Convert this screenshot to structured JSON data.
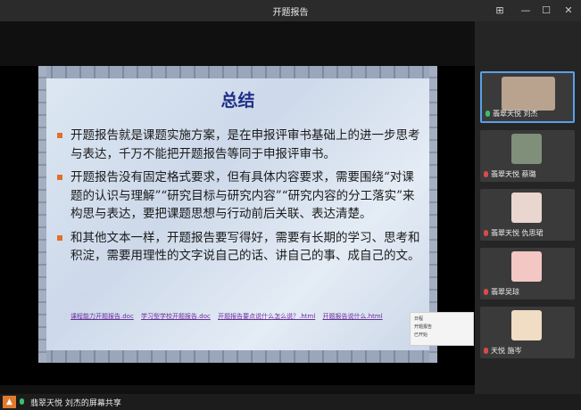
{
  "window": {
    "title": "开题报告"
  },
  "slide": {
    "title": "总结",
    "bullets": [
      "开题报告就是课题实施方案，是在申报评审书基础上的进一步思考与表达，千万不能把开题报告等同于申报评审书。",
      "开题报告没有固定格式要求，但有具体内容要求，需要围绕“对课题的认识与理解”“研究目标与研究内容”“研究内容的分工落实”来构思与表达，要把课题思想与行动前后关联、表达清楚。",
      "和其他文本一样，开题报告要写得好，需要有长期的学习、思考和积淀，需要用理性的文字说自己的话、讲自己的事、成自己的文。"
    ],
    "links": [
      "课程能力开题报告.doc",
      "学习型学校开题报告.doc",
      "开题报告要点说什么怎么说？.html",
      "开题报告说什么.html"
    ]
  },
  "popup": {
    "items": [
      "日程",
      "开题报告",
      "已开始"
    ]
  },
  "participants": [
    {
      "label": "翡翠天悦 刘杰",
      "mic": "on",
      "active": true,
      "avatar_color": "#b9a38f"
    },
    {
      "label": "翡翠天悦 蔡璐",
      "mic": "off",
      "active": false,
      "avatar_color": "#7f8f7a"
    },
    {
      "label": "翡翠天悦 仇思珺",
      "mic": "off",
      "active": false,
      "avatar_color": "#e9d6cf"
    },
    {
      "label": "翡翠吴琼",
      "mic": "off",
      "active": false,
      "avatar_color": "#f3c7c4"
    },
    {
      "label": "天悦 施岑",
      "mic": "off",
      "active": false,
      "avatar_color": "#f1dcc4"
    }
  ],
  "bottom": {
    "sharing_label": "翡翠天悦  刘杰的屏幕共享"
  },
  "colors": {
    "accent": "#5aa0e6",
    "share_orange": "#e07a2e"
  }
}
